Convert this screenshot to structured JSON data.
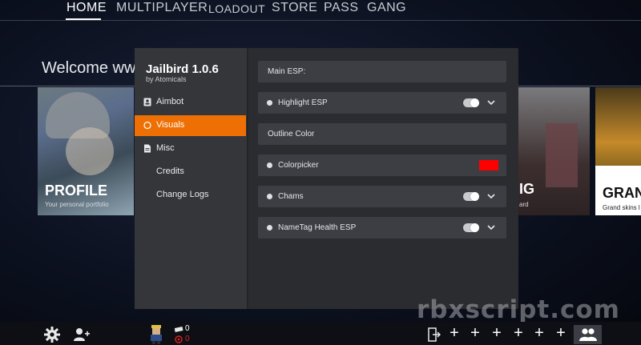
{
  "topnav": {
    "items": [
      {
        "label": "HOME",
        "active": true
      },
      {
        "label": "MULTIPLAYER",
        "active": false
      },
      {
        "label": "LOADOUT",
        "active": false
      },
      {
        "label": "STORE",
        "active": false
      },
      {
        "label": "PASS",
        "active": false
      },
      {
        "label": "GANG",
        "active": false
      }
    ]
  },
  "welcome": {
    "text": "Welcome wwe"
  },
  "cards": {
    "profile": {
      "title": "PROFILE",
      "subtitle": "Your personal portfolio"
    },
    "shop": {
      "title": "IG",
      "subtitle": "ard"
    },
    "grand": {
      "title": "GRAN",
      "subtitle": "Grand skins l"
    }
  },
  "gui": {
    "title": "Jailbird 1.0.6",
    "subtitle": "by Atomicals",
    "sidebar": [
      {
        "label": "Aimbot",
        "icon": "user-card-icon",
        "active": false
      },
      {
        "label": "Visuals",
        "icon": "circle-icon",
        "active": true
      },
      {
        "label": "Misc",
        "icon": "document-icon",
        "active": false
      },
      {
        "label": "Credits",
        "icon": "",
        "active": false
      },
      {
        "label": "Change Logs",
        "icon": "",
        "active": false
      }
    ],
    "rows": [
      {
        "label": "Main ESP:",
        "type": "header"
      },
      {
        "label": "Highlight ESP",
        "type": "toggle"
      },
      {
        "label": "Outline Color",
        "type": "header"
      },
      {
        "label": "Colorpicker",
        "type": "color",
        "color": "#ff0000"
      },
      {
        "label": "Chams",
        "type": "toggle"
      },
      {
        "label": "NameTag Health ESP",
        "type": "toggle"
      }
    ],
    "accent": "#ee7004"
  },
  "bottombar": {
    "stat_top": "0",
    "stat_bottom": "0",
    "plus_label": "+"
  },
  "watermark": "rbxscript.com"
}
